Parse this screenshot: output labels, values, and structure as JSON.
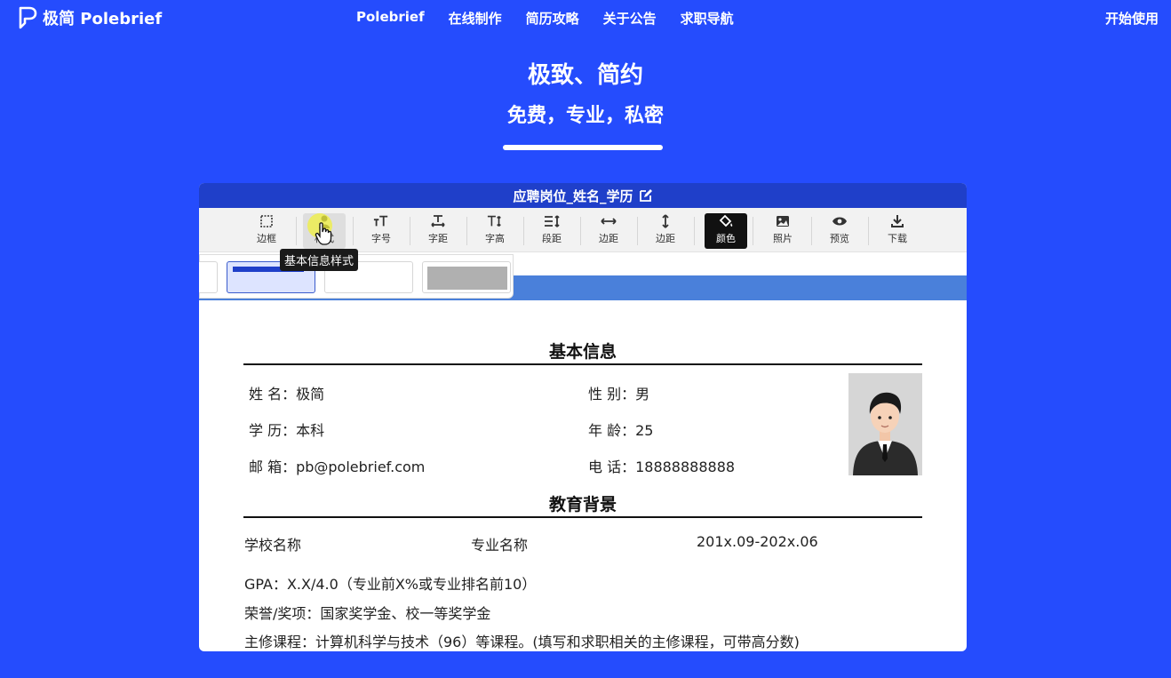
{
  "brand": {
    "name": "极简 Polebrief"
  },
  "nav": [
    {
      "label": "Polebrief"
    },
    {
      "label": "在线制作"
    },
    {
      "label": "简历攻略"
    },
    {
      "label": "关于公告"
    },
    {
      "label": "求职导航"
    }
  ],
  "start_label": "开始使用",
  "hero": {
    "title": "极致、简约",
    "subtitle": "免费，专业，私密"
  },
  "editor": {
    "doc_title": "应聘岗位_姓名_学历",
    "tools": [
      {
        "label": "边框",
        "icon": "border-icon"
      },
      {
        "label": "样式",
        "icon": "person-style-icon"
      },
      {
        "label": "字号",
        "icon": "font-size-icon"
      },
      {
        "label": "字距",
        "icon": "letter-spacing-icon"
      },
      {
        "label": "字高",
        "icon": "line-height-icon"
      },
      {
        "label": "段距",
        "icon": "paragraph-spacing-icon"
      },
      {
        "label": "边距",
        "icon": "horizontal-margin-icon"
      },
      {
        "label": "边距",
        "icon": "vertical-margin-icon"
      },
      {
        "label": "颜色",
        "icon": "paint-bucket-icon"
      },
      {
        "label": "照片",
        "icon": "image-icon"
      },
      {
        "label": "预览",
        "icon": "eye-icon"
      },
      {
        "label": "下载",
        "icon": "download-icon"
      }
    ],
    "tooltip": "基本信息样式",
    "accent": "#1f3fc9"
  },
  "resume": {
    "basic": {
      "title": "基本信息",
      "name": "姓 名：极简",
      "gender": "性 别：男",
      "education": "学 历：本科",
      "age": "年 龄：25",
      "email": "邮 箱：pb@polebrief.com",
      "phone": "电 话：18888888888"
    },
    "edu": {
      "title": "教育背景",
      "school": "学校名称",
      "major": "专业名称",
      "period": "201x.09-202x.06",
      "gpa": "GPA：X.X/4.0（专业前X%或专业排名前10）",
      "honors": "荣誉/奖项：国家奖学金、校一等奖学金",
      "courses": "主修课程：计算机科学与技术（96）等课程。(填写和求职相关的主修课程，可带高分数)"
    }
  }
}
